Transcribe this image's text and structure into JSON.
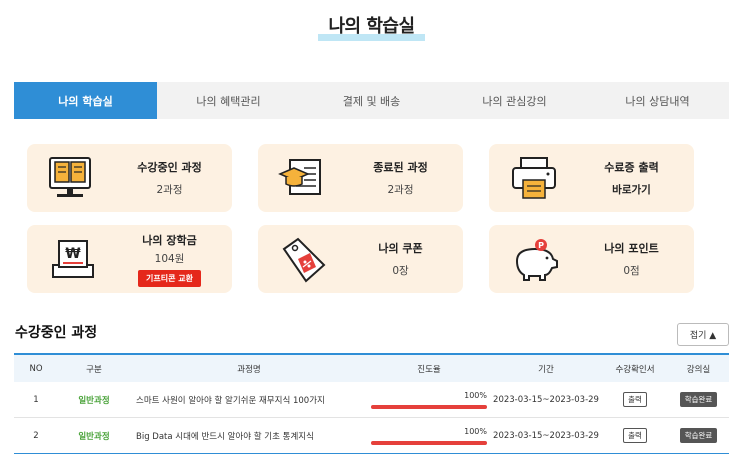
{
  "page": {
    "title": "나의 학습실"
  },
  "tabs": [
    {
      "label": "나의 학습실",
      "active": true
    },
    {
      "label": "나의 혜택관리",
      "active": false
    },
    {
      "label": "결제 및 배송",
      "active": false
    },
    {
      "label": "나의 관심강의",
      "active": false
    },
    {
      "label": "나의 상담내역",
      "active": false
    }
  ],
  "cards": {
    "in_progress": {
      "title": "수강중인 과정",
      "value": "2과정",
      "icon": "monitor-book-icon"
    },
    "completed": {
      "title": "종료된 과정",
      "value": "2과정",
      "icon": "graduation-scroll-icon"
    },
    "certificate": {
      "title": "수료증 출력",
      "value": "바로가기",
      "icon": "printer-icon"
    },
    "scholarship": {
      "title": "나의 장학금",
      "value": "104원",
      "button": "기프티콘 교환",
      "icon": "won-register-icon"
    },
    "coupon": {
      "title": "나의 쿠폰",
      "value": "0장",
      "icon": "coupon-tag-icon"
    },
    "points": {
      "title": "나의 포인트",
      "value": "0점",
      "icon": "piggy-bank-icon"
    }
  },
  "courses": {
    "title": "수강중인 과정",
    "collapse_label": "접기 ▲",
    "headers": [
      "NO",
      "구분",
      "과정명",
      "진도율",
      "기간",
      "수강확인서",
      "강의실"
    ],
    "rows": [
      {
        "no": "1",
        "category": "일반과정",
        "name": "스마트 사원이 알아야 할 알기쉬운 재무지식 100가지",
        "progress_label": "100%",
        "progress": 1.0,
        "period": "2023-03-15~2023-03-29",
        "print": "출력",
        "status": "학습완료"
      },
      {
        "no": "2",
        "category": "일반과정",
        "name": "Big Data 시대에 반드시 알아야 할 기초 통계지식",
        "progress_label": "100%",
        "progress": 1.0,
        "period": "2023-03-15~2023-03-29",
        "print": "출력",
        "status": "학습완료"
      }
    ]
  },
  "colors": {
    "accent": "#2f8ed6",
    "card_bg": "#fdf1e2",
    "progress": "#e5403b",
    "category": "#4aa33a"
  }
}
